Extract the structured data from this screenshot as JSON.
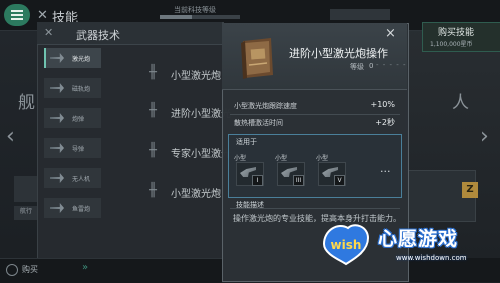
{
  "top_bar": {
    "title": "技能",
    "tech_label": "当前科技等级"
  },
  "panel": {
    "title": "武器技术",
    "categories": [
      {
        "label": "激光炮",
        "active": true
      },
      {
        "label": "磁轨炮",
        "active": false
      },
      {
        "label": "炮弹",
        "active": false
      },
      {
        "label": "导弹",
        "active": false
      },
      {
        "label": "无人机",
        "active": false
      },
      {
        "label": "鱼雷炮",
        "active": false
      }
    ],
    "skills": [
      "小型激光炮",
      "进阶小型激光",
      "专家小型激光",
      "小型激光炮"
    ]
  },
  "background": {
    "left_text": "舰",
    "right_text": "人",
    "left_card_label": "航行",
    "purchase_label": "购买"
  },
  "buy": {
    "label": "购买技能",
    "cost": "1,100,000星币"
  },
  "popup": {
    "title": "进阶小型激光炮操作",
    "level_label": "等级",
    "level_value": "0",
    "level_dashes": "- - - - -",
    "close_icon": "×",
    "stats": [
      {
        "label": "小型激光炮跟踪速度",
        "value": "+10%"
      },
      {
        "label": "散热槽激活时间",
        "value": "+2秒"
      }
    ],
    "applies_title": "适用于",
    "applies": [
      {
        "label": "小型",
        "tier": "I"
      },
      {
        "label": "小型",
        "tier": "III"
      },
      {
        "label": "小型",
        "tier": "V"
      }
    ],
    "more": "···",
    "desc_title": "技能描述",
    "desc_text": "操作激光炮的专业技能，提高本身升打击能力。"
  },
  "watermark": {
    "brand": "wish",
    "name": "心愿游戏",
    "url": "www.wishdown.com"
  }
}
